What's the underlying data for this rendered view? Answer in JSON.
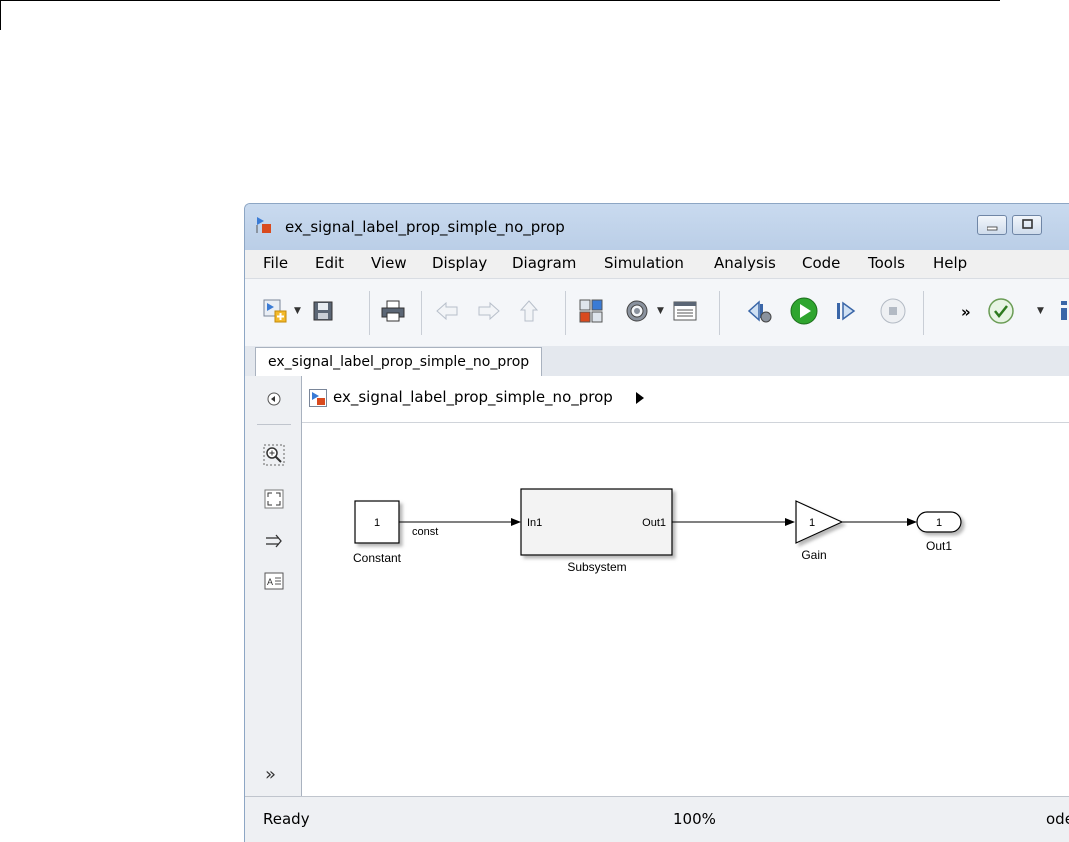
{
  "window": {
    "title": "ex_signal_label_prop_simple_no_prop"
  },
  "menu": {
    "items": [
      "File",
      "Edit",
      "View",
      "Display",
      "Diagram",
      "Simulation",
      "Analysis",
      "Code",
      "Tools",
      "Help"
    ]
  },
  "toolbar": {
    "overflow_label": "»"
  },
  "tab": {
    "label": "ex_signal_label_prop_simple_no_prop"
  },
  "breadcrumb": {
    "model": "ex_signal_label_prop_simple_no_prop"
  },
  "sidebar": {
    "more_label": "»"
  },
  "diagram": {
    "constant": {
      "value": "1",
      "name": "Constant"
    },
    "signal_label": "const",
    "subsystem": {
      "in_port": "In1",
      "out_port": "Out1",
      "name": "Subsystem"
    },
    "gain": {
      "value": "1",
      "name": "Gain"
    },
    "outport": {
      "value": "1",
      "name": "Out1"
    }
  },
  "status": {
    "ready": "Ready",
    "zoom": "100%",
    "solver": "ode"
  },
  "colors": {
    "run_green": "#2fa52f",
    "title_gradient": "#c9daef",
    "window_border": "#8da6c4"
  }
}
